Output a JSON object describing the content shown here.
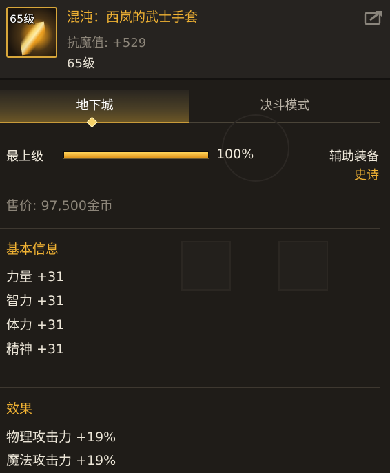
{
  "item": {
    "level_tag": "65级",
    "name": "混沌：西岚的武士手套",
    "magic_resist_label": "抗魔值:",
    "magic_resist_value": "+529",
    "level": "65级"
  },
  "tabs": [
    {
      "label": "地下城",
      "active": true
    },
    {
      "label": "决斗模式",
      "active": false
    }
  ],
  "upgrade": {
    "label": "最上级",
    "progress": 1.0,
    "percent_text": "100%"
  },
  "equipment_type": {
    "label": "辅助装备",
    "rarity": "史诗"
  },
  "price": "售价: 97,500金币",
  "basic_info": {
    "title": "基本信息",
    "stats": [
      "力量 +31",
      "智力 +31",
      "体力 +31",
      "精神 +31"
    ]
  },
  "effects": {
    "title": "效果",
    "stats": [
      "物理攻击力 +19%",
      "魔法攻击力 +19%"
    ]
  },
  "colors": {
    "accent_gold": "#f0b233",
    "rarity_epic": "#f0b233",
    "text_muted": "#8c8579",
    "background": "#1f1c18"
  },
  "icons": {
    "item_icon": "gauntlet-icon",
    "share_icon": "share-icon"
  }
}
